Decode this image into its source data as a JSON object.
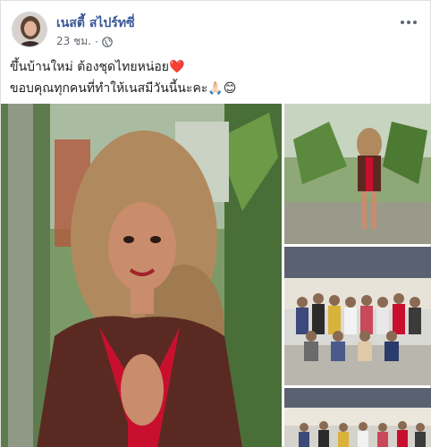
{
  "post": {
    "author": "เนสตี้ สไปร์ทซี่",
    "time": "23 ชม.",
    "separator": "·",
    "privacy_icon": "globe-icon",
    "more_icon": "more-options-icon",
    "text_line1": "ขึ้นบ้านใหม่ ต้องชุดไทยหน่อย❤️",
    "text_line2": "ขอบคุณทุกคนที่ทำให้เนสมีวันนี้นะคะ🙏🏻😊"
  },
  "photos": {
    "main": "woman-in-thai-dress-photo",
    "side1": "standing-pose-photo",
    "side2": "group-photo",
    "side3": "group-photo-2"
  },
  "colors": {
    "author_link": "#385898",
    "dress_red": "#c8102e",
    "dress_brown": "#5a2a22",
    "foliage": "#4f7a3a"
  }
}
